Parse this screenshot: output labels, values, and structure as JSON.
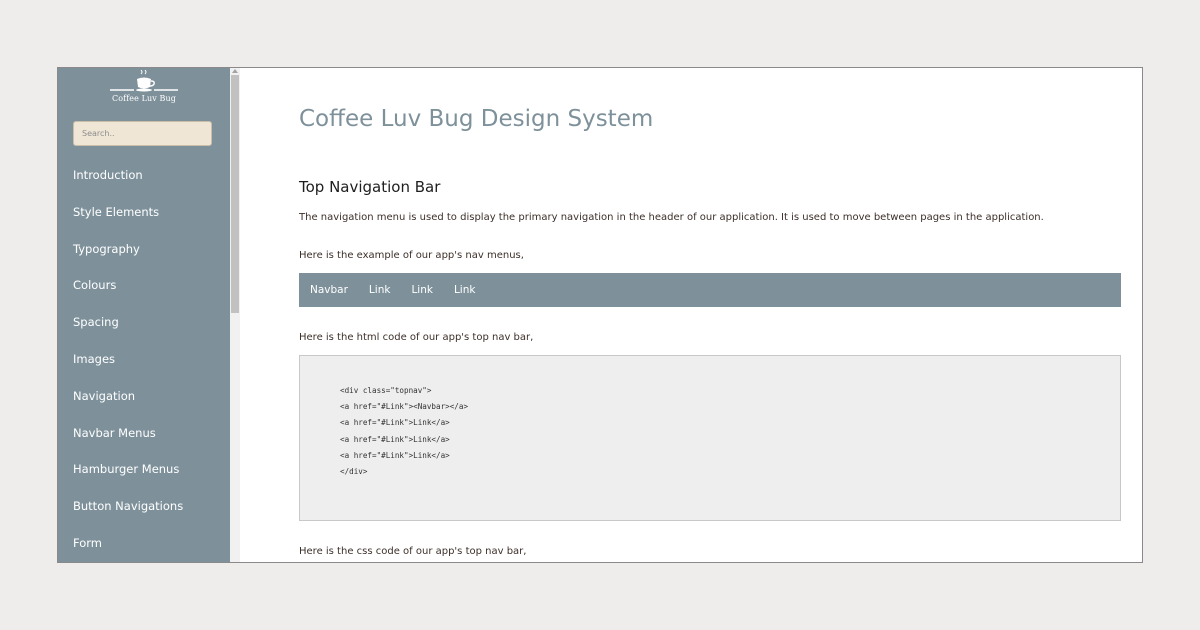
{
  "brand": {
    "name": "Coffee Luv Bug"
  },
  "search": {
    "placeholder": "Search.."
  },
  "sidebar": {
    "items": [
      {
        "label": "Introduction"
      },
      {
        "label": "Style Elements"
      },
      {
        "label": "Typography"
      },
      {
        "label": "Colours"
      },
      {
        "label": "Spacing"
      },
      {
        "label": "Images"
      },
      {
        "label": "Navigation"
      },
      {
        "label": "Navbar Menus"
      },
      {
        "label": "Hamburger Menus"
      },
      {
        "label": "Button Navigations"
      },
      {
        "label": "Form"
      }
    ]
  },
  "main": {
    "title": "Coffee Luv Bug Design System",
    "section_title": "Top Navigation Bar",
    "description": "The navigation menu is used to display the primary navigation in the header of our application. It is used to move between pages in the application.",
    "example_intro": "Here is the example of our app's nav menus,",
    "demo_nav": [
      "Navbar",
      "Link",
      "Link",
      "Link"
    ],
    "html_intro": "Here is the html code of our app's top nav bar,",
    "code_lines": [
      "<div class=\"topnav\">",
      "<a href=\"#Link\"><Navbar></a>",
      "<a href=\"#Link\">Link</a>",
      "<a href=\"#Link\">Link</a>",
      "<a href=\"#Link\">Link</a>",
      "</div>"
    ],
    "css_intro": "Here is the css code of our app's top nav bar,"
  },
  "colors": {
    "sidebar_bg": "#7e919b",
    "search_bg": "#efe6d6",
    "page_bg": "#eeedeb",
    "title": "#7e919b"
  },
  "icons": {
    "logo": "coffee-cup-icon"
  }
}
